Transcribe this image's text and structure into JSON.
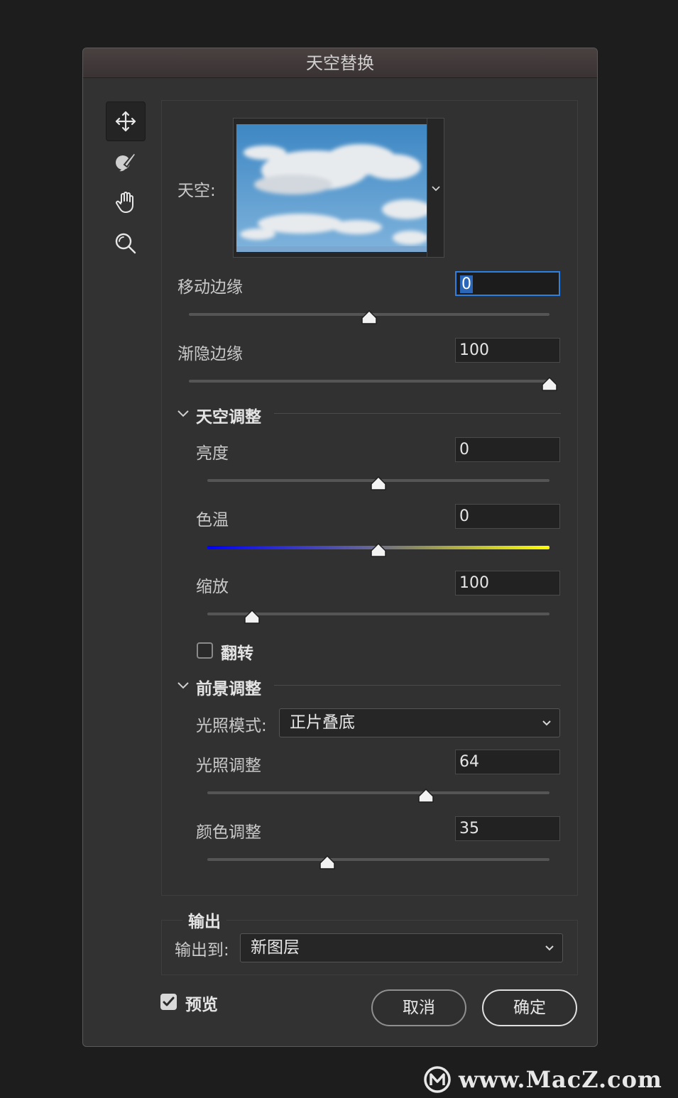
{
  "dialog": {
    "title": "天空替换"
  },
  "tools": [
    {
      "name": "move-tool",
      "icon": "move-icon",
      "active": true
    },
    {
      "name": "sky-brush-tool",
      "icon": "brush-icon",
      "active": false
    },
    {
      "name": "hand-tool",
      "icon": "hand-icon",
      "active": false
    },
    {
      "name": "zoom-tool",
      "icon": "zoom-icon",
      "active": false
    }
  ],
  "sky": {
    "label": "天空:",
    "dropdown_icon": "chevron-down-icon"
  },
  "shift_edge": {
    "label": "移动边缘",
    "value": "0",
    "fraction": 0.5
  },
  "fade_edge": {
    "label": "渐隐边缘",
    "value": "100",
    "fraction": 1.0
  },
  "sky_adjust": {
    "heading": "天空调整",
    "brightness": {
      "label": "亮度",
      "value": "0",
      "fraction": 0.5
    },
    "temperature": {
      "label": "色温",
      "value": "0",
      "fraction": 0.5,
      "gradient_from": "#0000ff",
      "gradient_to": "#ffff00"
    },
    "scale": {
      "label": "缩放",
      "value": "100",
      "fraction": 0.13
    },
    "flip": {
      "label": "翻转",
      "checked": false
    }
  },
  "foreground_adjust": {
    "heading": "前景调整",
    "lighting_mode": {
      "label": "光照模式:",
      "value": "正片叠底"
    },
    "lighting_adjust": {
      "label": "光照调整",
      "value": "64",
      "fraction": 0.64
    },
    "color_adjust": {
      "label": "颜色调整",
      "value": "35",
      "fraction": 0.35
    }
  },
  "output": {
    "heading": "输出",
    "label": "输出到:",
    "value": "新图层"
  },
  "preview": {
    "label": "预览",
    "checked": true
  },
  "buttons": {
    "cancel": "取消",
    "ok": "确定"
  },
  "watermark": {
    "text": "www.MacZ.com"
  },
  "colors": {
    "accent": "#2c7fe3",
    "dialog_bg": "#323232",
    "page_bg": "#1d1d1d"
  }
}
